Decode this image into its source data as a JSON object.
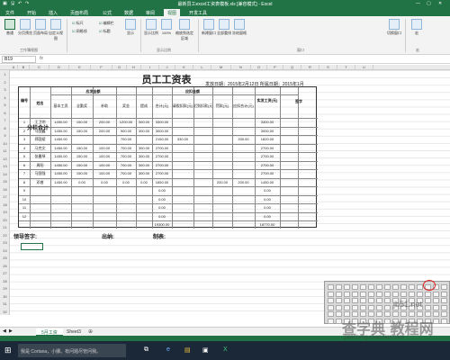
{
  "window": {
    "title": "最新员工excel工资表模板.xls [兼容模式] - Excel"
  },
  "tabs": [
    "文件",
    "开始",
    "插入",
    "页面布局",
    "公式",
    "数据",
    "审阅",
    "视图",
    "开发工具"
  ],
  "active_tab": "视图",
  "ribbon": {
    "buttons": [
      "普通",
      "分页预览",
      "页面布局",
      "自定义视图",
      "显示",
      "显示比例",
      "100%",
      "缩放到选定区域",
      "新建窗口",
      "全部重排",
      "冻结窗格",
      "切换窗口",
      "宏"
    ],
    "groups": [
      "工作簿视图",
      "显示比例",
      "窗口",
      "宏"
    ]
  },
  "formula_bar": {
    "name_box": "B19",
    "fx": "fx"
  },
  "columns": [
    "A",
    "B",
    "C",
    "D",
    "E",
    "F",
    "G",
    "H",
    "I",
    "J",
    "K",
    "L",
    "M",
    "N",
    "O",
    "P",
    "Q",
    "R",
    "S",
    "T",
    "U"
  ],
  "rows": [
    "1",
    "2",
    "3",
    "4",
    "5",
    "6",
    "7",
    "8",
    "9",
    "10",
    "11",
    "12",
    "13",
    "14",
    "15",
    "16",
    "17",
    "18",
    "19",
    "20",
    "21",
    "22",
    "23",
    "24",
    "25",
    "26",
    "27",
    "28",
    "29",
    "30",
    "31",
    "32"
  ],
  "sheet": {
    "title": "员工工资表",
    "issue_date": "发放日期：2015年2月12日 所属日期：2015年1月",
    "header_num": "编号",
    "header_name": "姓名",
    "header_payable": "应发金额",
    "header_deduct": "应扣金额",
    "header_actual": "实发工资(元)",
    "header_sign": "签字",
    "sub_headers": [
      "基本工资",
      "全勤奖",
      "补助",
      "奖金",
      "提成",
      "合计(元)",
      "请假扣款(元)",
      "迟到扣款(元)",
      "罚款(元)",
      "应扣合计(元)"
    ],
    "employees": [
      {
        "no": "1",
        "name": "王卫明",
        "vals": [
          "1450.00",
          "150.00",
          "200.00",
          "1200.00",
          "300.00",
          "3300.00",
          "",
          "",
          "",
          "",
          "3300.00"
        ]
      },
      {
        "no": "2",
        "name": "马国鑫",
        "vals": [
          "1450.00",
          "150.00",
          "200.00",
          "900.00",
          "300.00",
          "3000.00",
          "",
          "",
          "",
          "",
          "3000.00"
        ]
      },
      {
        "no": "3",
        "name": "郑国斌",
        "vals": [
          "1450.00",
          "",
          "",
          "700.00",
          "",
          "2150.00",
          "330.00",
          "",
          "",
          "330.00",
          "1820.00"
        ]
      },
      {
        "no": "4",
        "name": "马克文",
        "vals": [
          "1450.00",
          "150.00",
          "100.00",
          "700.00",
          "300.00",
          "2700.00",
          "",
          "",
          "",
          "",
          "2700.00"
        ]
      },
      {
        "no": "5",
        "name": "张曼琴",
        "vals": [
          "1450.00",
          "150.00",
          "100.00",
          "700.00",
          "300.00",
          "2700.00",
          "",
          "",
          "",
          "",
          "2700.00"
        ]
      },
      {
        "no": "6",
        "name": "周阳",
        "vals": [
          "1450.00",
          "150.00",
          "100.00",
          "700.00",
          "300.00",
          "2700.00",
          "",
          "",
          "",
          "",
          "2700.00"
        ]
      },
      {
        "no": "7",
        "name": "马国强",
        "vals": [
          "1450.00",
          "150.00",
          "100.00",
          "700.00",
          "300.00",
          "2700.00",
          "",
          "",
          "",
          "",
          "2700.00"
        ]
      },
      {
        "no": "8",
        "name": "邓睿",
        "vals": [
          "1450.00",
          "0.00",
          "0.00",
          "0.00",
          "0.00",
          "1650.00",
          "",
          "",
          "200.00",
          "200.00",
          "1450.00"
        ]
      },
      {
        "no": "9",
        "name": "",
        "vals": [
          "",
          "",
          "",
          "",
          "",
          "0.00",
          "",
          "",
          "",
          "",
          "0.00"
        ]
      },
      {
        "no": "10",
        "name": "",
        "vals": [
          "",
          "",
          "",
          "",
          "",
          "0.00",
          "",
          "",
          "",
          "",
          "0.00"
        ]
      },
      {
        "no": "11",
        "name": "",
        "vals": [
          "",
          "",
          "",
          "",
          "",
          "0.00",
          "",
          "",
          "",
          "",
          "0.00"
        ]
      },
      {
        "no": "12",
        "name": "",
        "vals": [
          "",
          "",
          "",
          "",
          "",
          "0.00",
          "",
          "",
          "",
          "",
          "0.00"
        ]
      }
    ],
    "subtotal_label": "分栏合计",
    "subtotal_total": "19300.00",
    "subtotal_actual": "18770.00",
    "sign_leader": "领导签字:",
    "sign_cashier": "出纳:",
    "sign_maker": "制表:"
  },
  "sheet_tabs": [
    "5月工资",
    "Sheet3"
  ],
  "active_sheet": "5月工资",
  "taskbar": {
    "search": "我是 Cortana，小娜。有问题尽管问我。"
  },
  "watermark": {
    "main": "查字典 教程网",
    "sub": "jb51.net",
    "url": "jiaocheng.chazidian.com"
  },
  "colors": {
    "excel_green": "#217346",
    "taskbar": "#1b2838"
  }
}
